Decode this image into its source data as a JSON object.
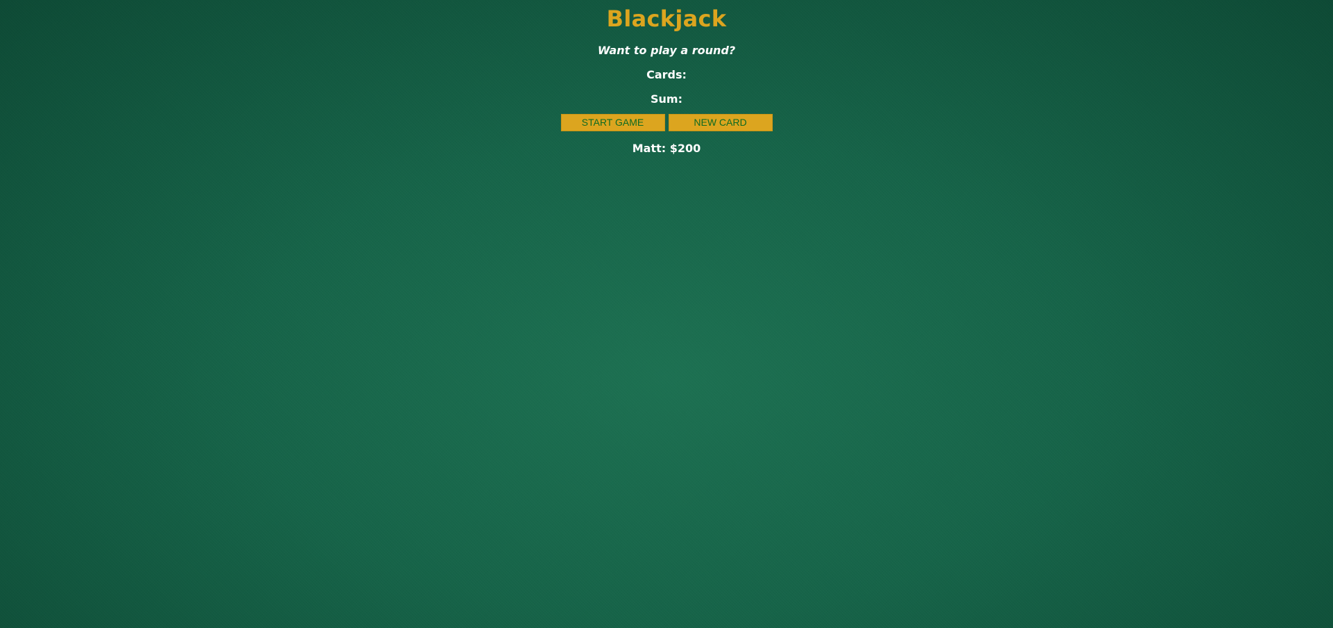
{
  "game": {
    "title": "Blackjack",
    "message": "Want to play a round?",
    "cards_label": "Cards:",
    "sum_label": "Sum:"
  },
  "buttons": {
    "start_label": "START GAME",
    "new_card_label": "NEW CARD"
  },
  "player": {
    "text": "Matt: $200"
  },
  "colors": {
    "accent": "#dca51f",
    "button_text": "#0d6a22",
    "felt": "#17654a"
  }
}
